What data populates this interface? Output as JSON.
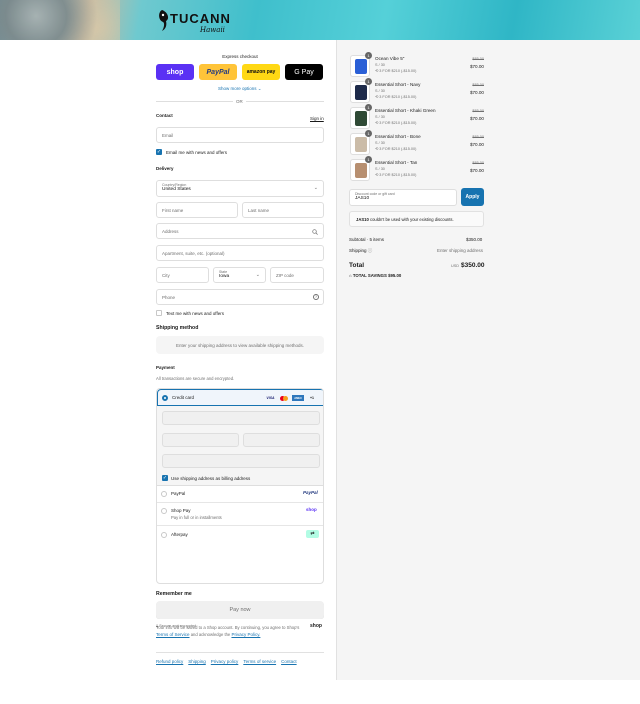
{
  "brand": {
    "logo_text": "TUCANN",
    "logo_sub": "Hawaii"
  },
  "express": {
    "title": "Express checkout",
    "shop": "shop",
    "paypal": "PayPal",
    "amazon": "amazon pay",
    "gpay": "G Pay",
    "more": "Show more options",
    "or": "OR"
  },
  "contact": {
    "title": "Contact",
    "signin": "Sign in",
    "email_placeholder": "Email",
    "news": "Email me with news and offers"
  },
  "delivery": {
    "title": "Delivery",
    "country_label": "Country/Region",
    "country_value": "United States",
    "first": "First name",
    "last": "Last name",
    "address": "Address",
    "apt": "Apartment, suite, etc. (optional)",
    "city": "City",
    "state_label": "State",
    "state_value": "Iowa",
    "zip": "ZIP code",
    "phone": "Phone",
    "text_news": "Text me with news and offers"
  },
  "shipping": {
    "title": "Shipping method",
    "note": "Enter your shipping address to view available shipping methods."
  },
  "payment": {
    "title": "Payment",
    "subtitle": "All transactions are secure and encrypted.",
    "credit": "Credit card",
    "visa": "VISA",
    "amex": "AMEX",
    "more_cards": "+1",
    "billing": "Use shipping address as billing address",
    "paypal": "PayPal",
    "paypal_logo": "PayPal",
    "shoppay": "Shop Pay",
    "shoppay_sub": "Pay in full or in installments",
    "shoppay_logo": "shop",
    "afterpay": "Afterpay"
  },
  "remember": {
    "title": "Remember me",
    "save": "Save my information for a faster checkout with a Shop account",
    "secure": "Secure and encrypted",
    "shop_logo": "shop"
  },
  "pay_now": "Pay now",
  "legal": {
    "text1": "Your info will be saved to a Shop account. By continuing, you agree to Shop's",
    "terms": "Terms of Service",
    "and": "and acknowledge the",
    "privacy": "Privacy Policy."
  },
  "footer": [
    "Refund policy",
    "Shipping",
    "Privacy policy",
    "Terms of service",
    "Contact"
  ],
  "cart": {
    "items": [
      {
        "name": "Ocean Vibe 5\"",
        "variant": "S / 30",
        "discount": "3 FOR $210 (-$15.00)",
        "orig": "$85.00",
        "price": "$70.00",
        "qty": "1",
        "color": "#2a5fd6"
      },
      {
        "name": "Essential Short - Navy",
        "variant": "S / 30",
        "discount": "3 FOR $210 (-$15.00)",
        "orig": "$85.00",
        "price": "$70.00",
        "qty": "1",
        "color": "#1d2a4a"
      },
      {
        "name": "Essential Short - Khaki Green",
        "variant": "S / 30",
        "discount": "3 FOR $210 (-$15.00)",
        "orig": "$85.00",
        "price": "$70.00",
        "qty": "1",
        "color": "#2f4a35"
      },
      {
        "name": "Essential Short - Bone",
        "variant": "S / 30",
        "discount": "3 FOR $210 (-$15.00)",
        "orig": "$85.00",
        "price": "$70.00",
        "qty": "1",
        "color": "#cbbca8"
      },
      {
        "name": "Essential Short - Tan",
        "variant": "S / 30",
        "discount": "3 FOR $210 (-$15.00)",
        "orig": "$85.00",
        "price": "$70.00",
        "qty": "1",
        "color": "#b78f70"
      }
    ],
    "discount_label": "Discount code or gift card",
    "discount_value": "JAS10",
    "apply": "Apply",
    "error_code": "JAS10",
    "error_text": "couldn't be used with your existing discounts.",
    "subtotal_label": "Subtotal · 5 items",
    "subtotal": "$350.00",
    "shipping_label": "Shipping",
    "shipping_value": "Enter shipping address",
    "total_label": "Total",
    "currency": "USD",
    "total": "$350.00",
    "savings_label": "TOTAL SAVINGS",
    "savings": "$95.00"
  },
  "colors": {
    "accent": "#1773b0",
    "shop": "#5a31f4",
    "paypal": "#ffc439",
    "amazon": "#ffd814"
  }
}
